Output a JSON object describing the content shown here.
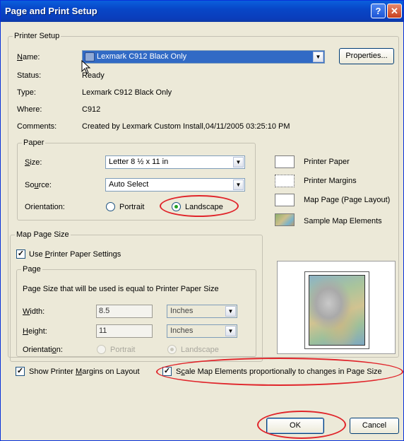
{
  "window": {
    "title": "Page and Print Setup",
    "help_symbol": "?",
    "close_symbol": "✕"
  },
  "printer_setup": {
    "legend": "Printer Setup",
    "name_label": "Name:",
    "name_value": "Lexmark C912 Black Only",
    "properties_label": "Properties...",
    "status_label": "Status:",
    "status_value": "Ready",
    "type_label": "Type:",
    "type_value": "Lexmark C912 Black Only",
    "where_label": "Where:",
    "where_value": "C912",
    "comments_label": "Comments:",
    "comments_value": "Created by Lexmark Custom Install,04/11/2005 03:25:10 PM"
  },
  "paper": {
    "legend": "Paper",
    "size_label": "Size:",
    "size_value": "Letter 8 ½ x 11 in",
    "source_label": "Source:",
    "source_value": "Auto Select",
    "orientation_label": "Orientation:",
    "portrait_label": "Portrait",
    "landscape_label": "Landscape",
    "selected": "landscape"
  },
  "legend_panel": {
    "items": [
      {
        "label": "Printer Paper"
      },
      {
        "label": "Printer Margins"
      },
      {
        "label": "Map Page (Page Layout)"
      },
      {
        "label": "Sample Map Elements"
      }
    ]
  },
  "map_page_size": {
    "legend": "Map Page Size",
    "use_printer_label": "Use Printer Paper Settings",
    "use_printer_checked": true,
    "page_legend": "Page",
    "page_info": "Page Size that will be used is equal to Printer Paper Size",
    "width_label": "Width:",
    "width_value": "8.5",
    "width_unit": "Inches",
    "height_label": "Height:",
    "height_value": "11",
    "height_unit": "Inches",
    "orientation_label": "Orientation:",
    "portrait_label": "Portrait",
    "landscape_label": "Landscape"
  },
  "options": {
    "show_margins_label": "Show Printer Margins on Layout",
    "show_margins_checked": true,
    "scale_label": "Scale Map Elements proportionally to changes in Page Size",
    "scale_checked": true
  },
  "buttons": {
    "ok_label": "OK",
    "cancel_label": "Cancel"
  },
  "colors": {
    "annotation": "#e0242a",
    "titlebar": "#0a5fdd"
  }
}
